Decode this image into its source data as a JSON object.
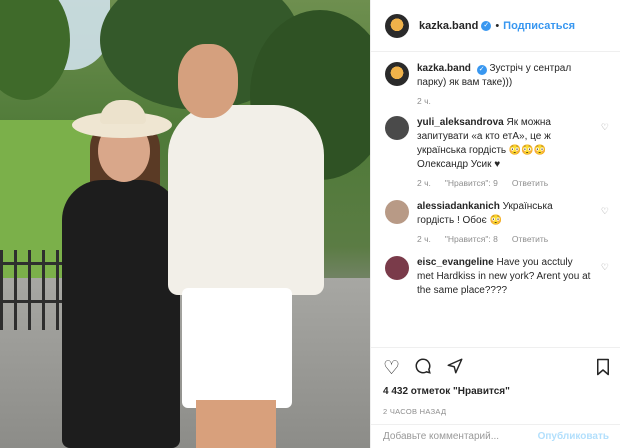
{
  "post": {
    "username": "kazka.band",
    "follow_label": "Подписаться",
    "verified_mark": "✓",
    "separator": "•"
  },
  "caption": {
    "username": "kazka.band",
    "text": "Зустріч у сентрал парку) як вам таке)))",
    "time": "2 ч."
  },
  "comments": [
    {
      "username": "yuli_aleksandrova",
      "text": "Як можна запитувати «а кто етА», це ж українська гордість 😳😳😳 Олександр Усик ♥",
      "time": "2 ч.",
      "likes": "\"Нравится\": 9",
      "reply": "Ответить",
      "avatar_color": "#4a4a4a"
    },
    {
      "username": "alessiadankanich",
      "text": "Українська гордість ! Обоє 😳",
      "time": "2 ч.",
      "likes": "\"Нравится\": 8",
      "reply": "Ответить",
      "avatar_color": "#b89a86"
    },
    {
      "username": "eisc_evangeline",
      "text": "Have you acctuly met Hardkiss in new york? Arent you at the same place????",
      "avatar_color": "#7a3b4a"
    }
  ],
  "stats": {
    "likes_text": "4 432 отметок \"Нравится\"",
    "posted": "2 ЧАСОВ НАЗАД"
  },
  "composer": {
    "placeholder": "Добавьте комментарий...",
    "publish_label": "Опубликовать"
  },
  "icons": {
    "like": "heart-icon",
    "comment": "comment-icon",
    "share": "share-icon",
    "save": "bookmark-icon"
  },
  "colors": {
    "link_blue": "#3897f0",
    "muted": "#8e8e8e",
    "publish_disabled": "#b2dffc"
  }
}
